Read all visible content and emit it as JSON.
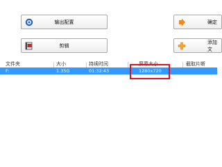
{
  "toolbar": {
    "output_config_label": "输出配置",
    "edit_label": "剪辑",
    "ok_label": "确定",
    "add_label": "添加文"
  },
  "table": {
    "headers": [
      "文件夹",
      "大小",
      "持续时间",
      "屏幕大小",
      "截取片断"
    ],
    "rows": [
      {
        "folder": "F:",
        "size": "1.35G",
        "duration": "01:32:43",
        "screen_size": "1280x720",
        "clip": ""
      }
    ]
  },
  "colors": {
    "selection": "#3399ff",
    "highlight": "#e0101f"
  },
  "icons": [
    "settings-disc-icon",
    "scissors-film-icon",
    "arrow-right-icon",
    "plus-icon"
  ]
}
